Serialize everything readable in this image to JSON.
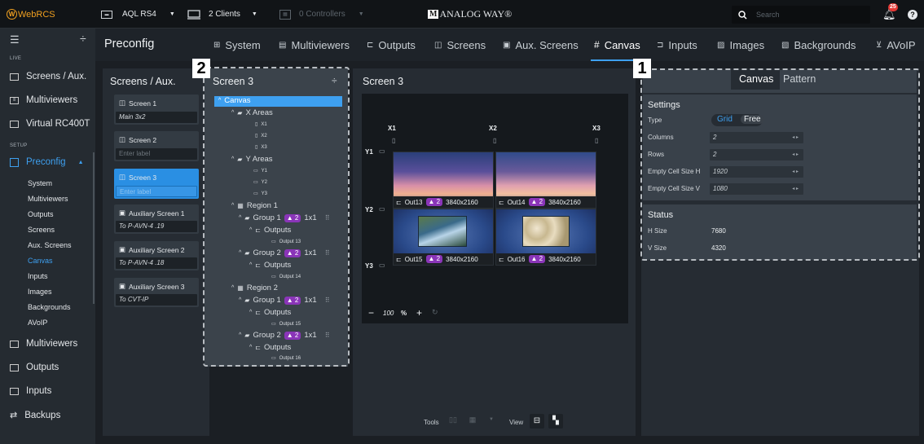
{
  "topbar": {
    "brand": "WebRCS",
    "device": "AQL RS4",
    "clients": "2 Clients",
    "controllers": "0 Controllers",
    "logo_text": "ANALOG WAY®",
    "search_placeholder": "Search",
    "notif_count": "25"
  },
  "sidebar": {
    "live_label": "LIVE",
    "live_items": [
      "Screens / Aux.",
      "Multiviewers",
      "Virtual RC400T"
    ],
    "setup_label": "SETUP",
    "preconfig_label": "Preconfig",
    "preconfig_subs": [
      "System",
      "Multiviewers",
      "Outputs",
      "Screens",
      "Aux. Screens",
      "Canvas",
      "Inputs",
      "Images",
      "Backgrounds",
      "AVoIP"
    ],
    "other_items": [
      "Multiviewers",
      "Outputs",
      "Inputs",
      "Backups"
    ]
  },
  "header": {
    "title": "Preconfig",
    "tabs": [
      "System",
      "Multiviewers",
      "Outputs",
      "Screens",
      "Aux. Screens",
      "Canvas",
      "Inputs",
      "Images",
      "Backgrounds",
      "AVoIP"
    ]
  },
  "screens_panel": {
    "title": "Screens / Aux.",
    "cards": [
      {
        "label": "Screen 1",
        "value": "Main 3x2"
      },
      {
        "label": "Screen 2",
        "value": "Enter label"
      },
      {
        "label": "Screen 3",
        "value": "Enter label"
      },
      {
        "label": "Auxiliary Screen 1",
        "value": "To P-AVN-4 .19"
      },
      {
        "label": "Auxiliary Screen 2",
        "value": "To P-AVN-4 .18"
      },
      {
        "label": "Auxiliary Screen 3",
        "value": "To CVT-IP"
      }
    ]
  },
  "tree_panel": {
    "title": "Screen 3",
    "badge": "2",
    "nodes": {
      "canvas": "Canvas",
      "x_areas": "X Areas",
      "x1": "X1",
      "x2": "X2",
      "x3": "X3",
      "y_areas": "Y Areas",
      "y1": "Y1",
      "y2": "Y2",
      "y3": "Y3",
      "region1": "Region 1",
      "region2": "Region 2",
      "group1": "Group 1",
      "group2": "Group 2",
      "chip": "2",
      "size": "1x1",
      "outputs": "Outputs",
      "out13": "Output 13",
      "out14": "Output 14",
      "out15": "Output 15",
      "out16": "Output 16"
    }
  },
  "canvas_panel": {
    "title": "Screen 3",
    "x_labels": [
      "X1",
      "X2",
      "X3"
    ],
    "y_labels": [
      "Y1",
      "Y2",
      "Y3"
    ],
    "tiles": [
      {
        "out": "Out13",
        "chip": "2",
        "res": "3840x2160"
      },
      {
        "out": "Out14",
        "chip": "2",
        "res": "3840x2160"
      },
      {
        "out": "Out15",
        "chip": "2",
        "res": "3840x2160"
      },
      {
        "out": "Out16",
        "chip": "2",
        "res": "3840x2160"
      }
    ],
    "zoom": "100",
    "zoom_unit": "%",
    "tools_label": "Tools",
    "view_label": "View"
  },
  "settings_panel": {
    "badge": "1",
    "tab_canvas": "Canvas",
    "tab_pattern": "Pattern",
    "settings_title": "Settings",
    "type_label": "Type",
    "type_grid": "Grid",
    "type_free": "Free",
    "columns_label": "Columns",
    "columns_value": "2",
    "rows_label": "Rows",
    "rows_value": "2",
    "ecs_h_label": "Empty Cell Size H",
    "ecs_h_value": "1920",
    "ecs_v_label": "Empty Cell Size V",
    "ecs_v_value": "1080",
    "status_title": "Status",
    "hsize_label": "H Size",
    "hsize_value": "7680",
    "vsize_label": "V Size",
    "vsize_value": "4320"
  }
}
